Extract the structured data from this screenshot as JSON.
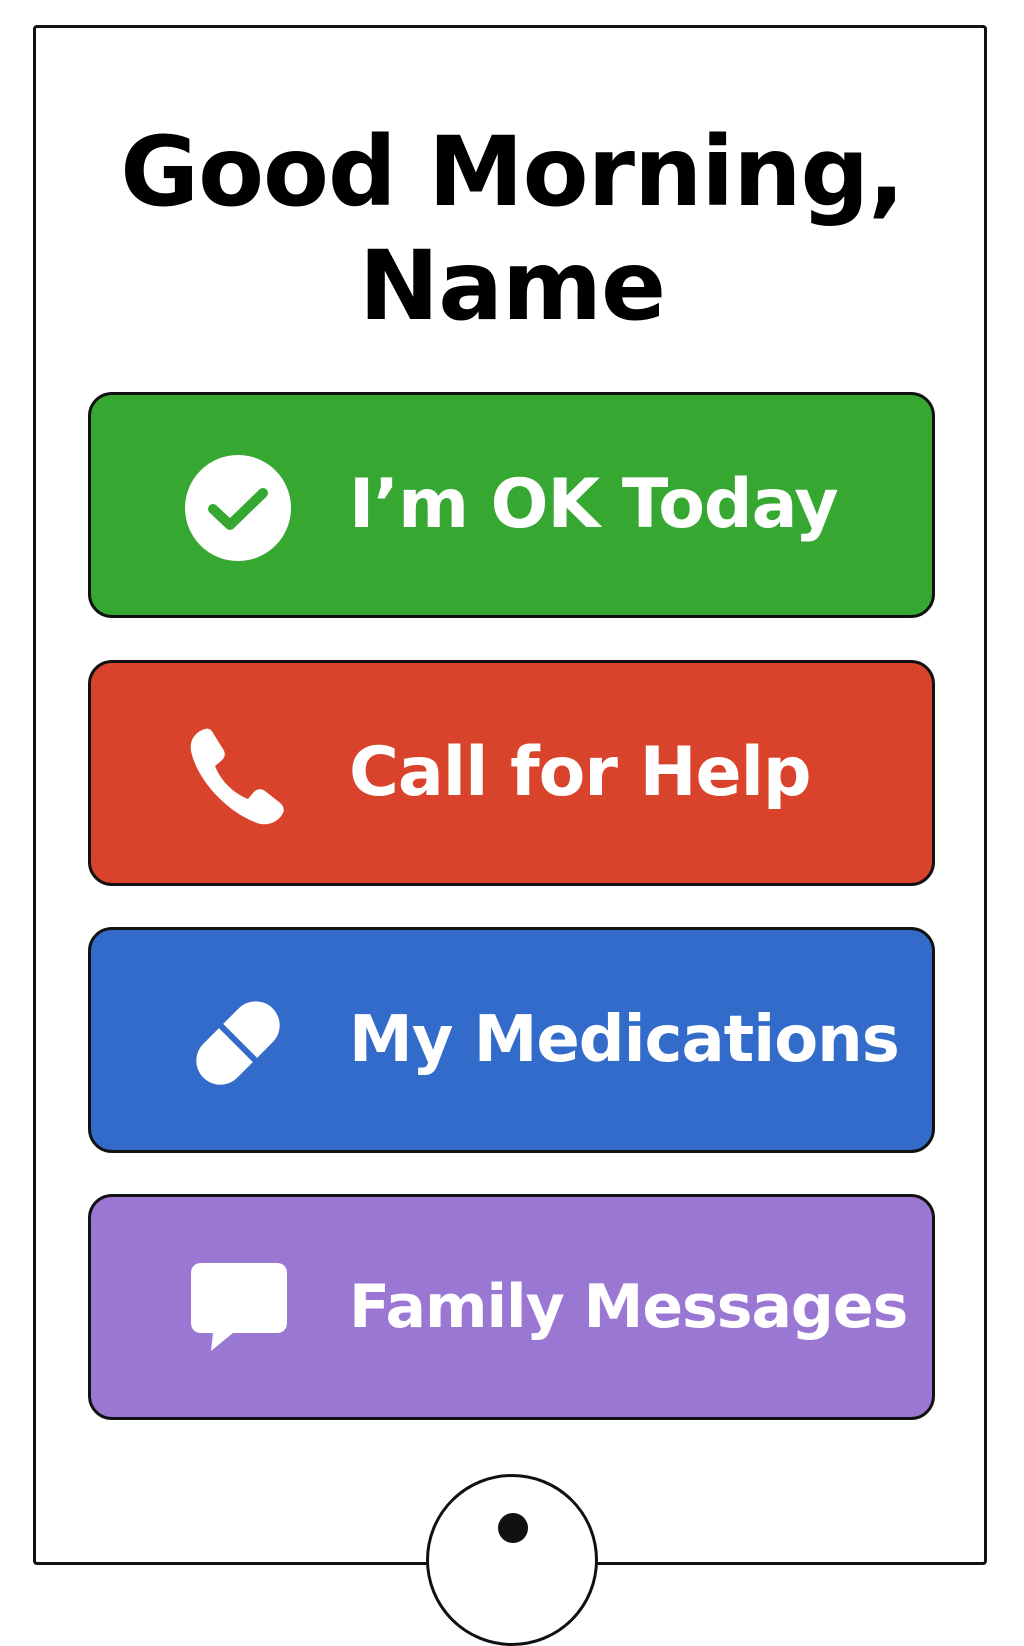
{
  "greeting": {
    "line1": "Good Morning,",
    "line2": "Name"
  },
  "buttons": [
    {
      "label": "I’m OK Today",
      "icon": "check-circle-icon",
      "color": "#36a832"
    },
    {
      "label": "Call for Help",
      "icon": "phone-icon",
      "color": "#d9432b"
    },
    {
      "label": "My Medications",
      "icon": "pill-icon",
      "color": "#336bca"
    },
    {
      "label": "Family Messages",
      "icon": "chat-bubble-icon",
      "color": "#9b77d4"
    }
  ],
  "colors": {
    "background": "#ffffff",
    "border": "#111111",
    "text_on_button": "#ffffff"
  }
}
